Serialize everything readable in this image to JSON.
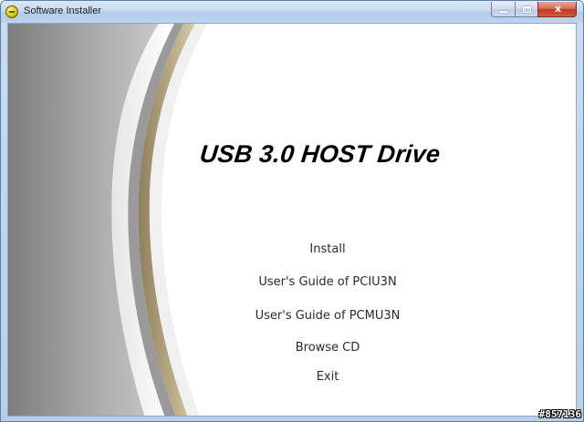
{
  "window": {
    "title": "Software Installer",
    "close_glyph": "x"
  },
  "main": {
    "headline": "USB 3.0 HOST Drive",
    "menu": [
      {
        "label": "Install"
      },
      {
        "label": "User's Guide of PCIU3N"
      },
      {
        "label": "User's Guide of PCMU3N"
      },
      {
        "label": "Browse CD"
      },
      {
        "label": "Exit"
      }
    ]
  },
  "watermark": "#857136",
  "colors": {
    "titlebar": "#c6daf2",
    "close_button": "#c03a20",
    "swoosh_gray": "#8c8c8c",
    "swoosh_accent": "#b4a07a",
    "text": "#2a2a2a"
  },
  "icons": [
    "app-icon",
    "minimize-icon",
    "maximize-icon",
    "close-icon"
  ]
}
